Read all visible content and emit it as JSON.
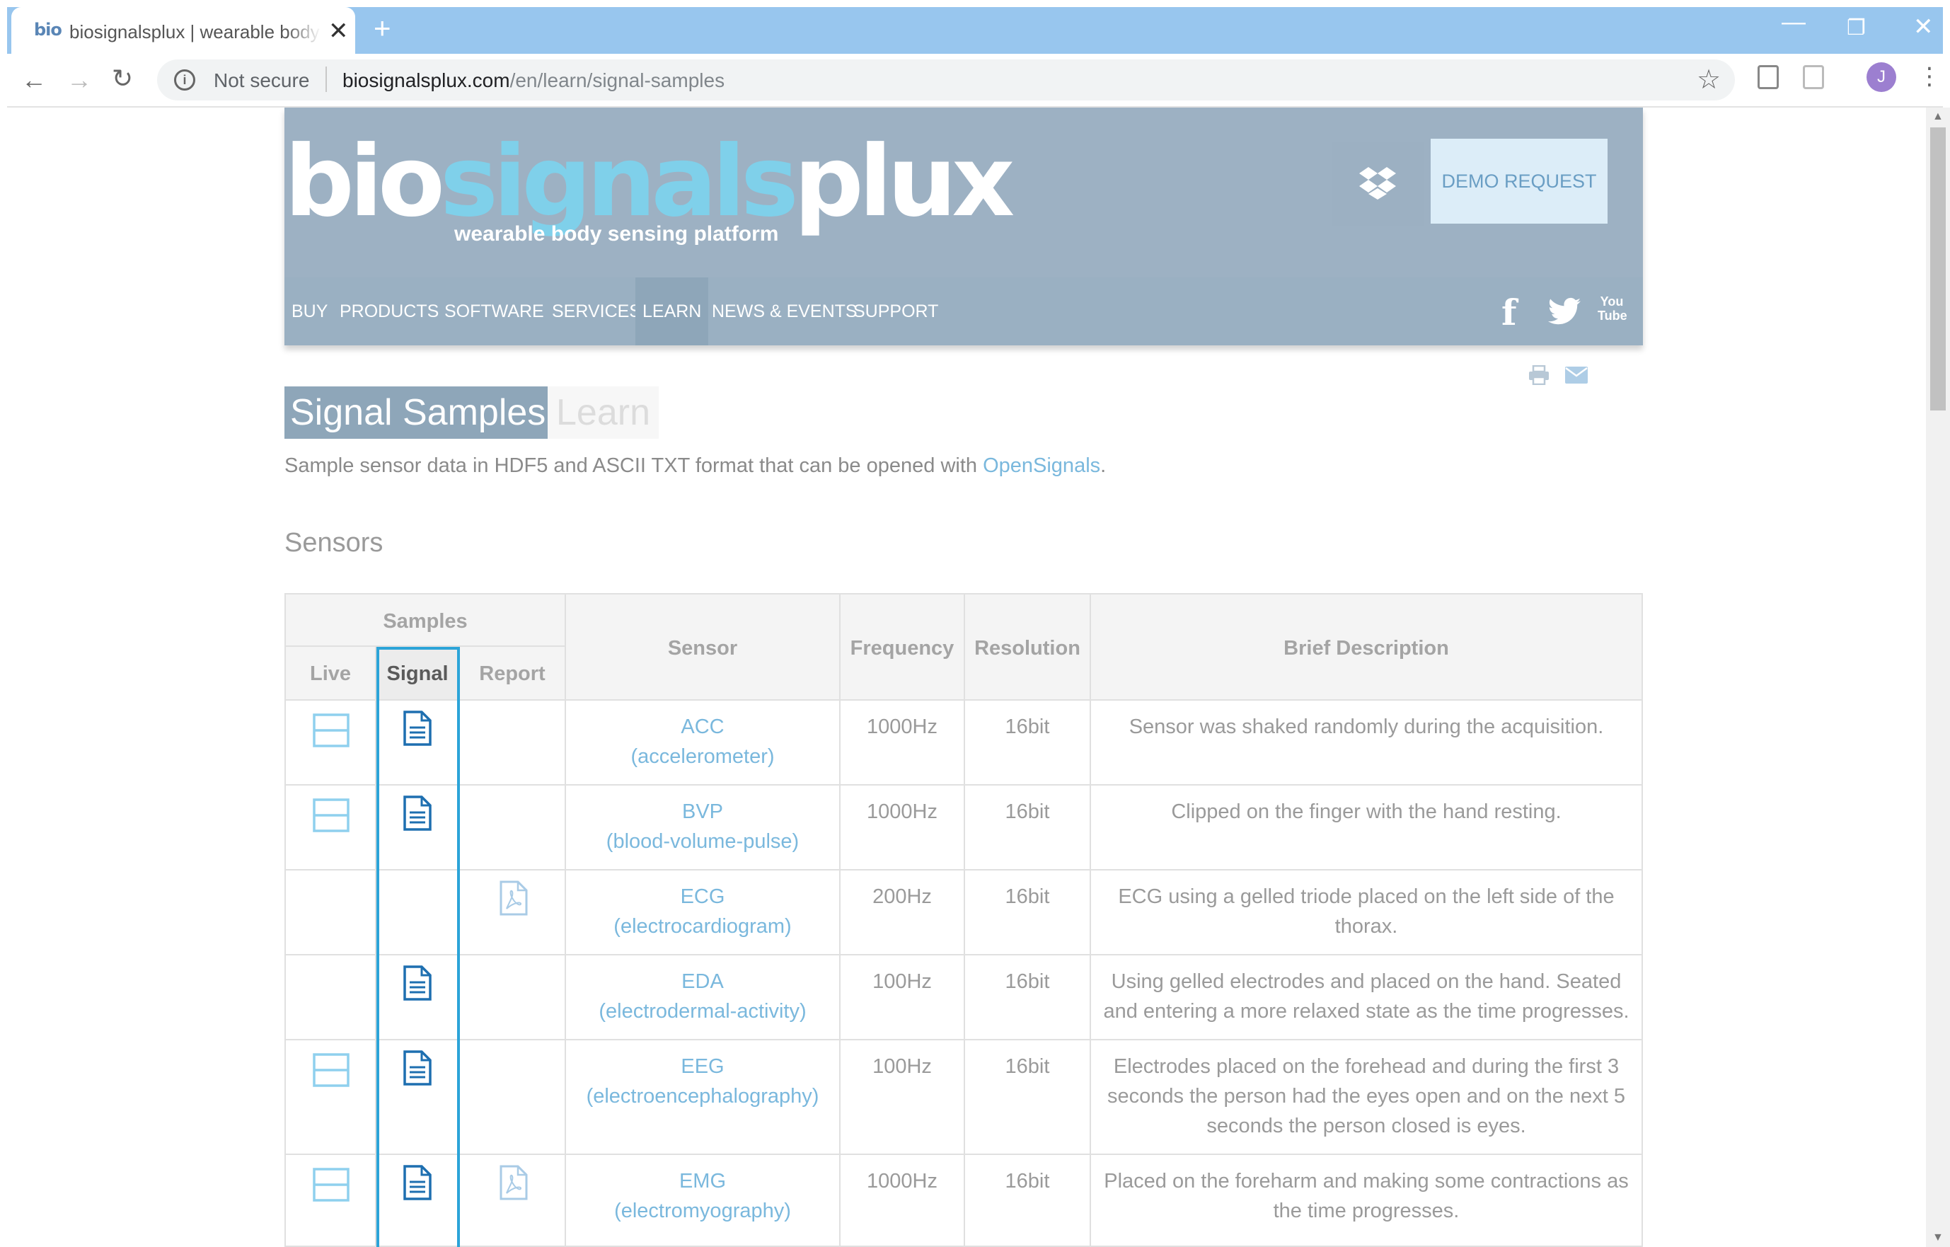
{
  "browser": {
    "tab_title": "biosignalsplux | wearable body sensing platform",
    "tab_favicon": "bio",
    "close_glyph": "✕",
    "new_tab_glyph": "+",
    "security_label": "Not secure",
    "url_host": "biosignalsplux.com",
    "url_path": "/en/learn/signal-samples",
    "profile_initial": "J"
  },
  "site": {
    "logo_parts": [
      "bio",
      "signals",
      "plux"
    ],
    "tagline": "wearable body sensing platform",
    "demo_button": "DEMO REQUEST",
    "nav": [
      "BUY",
      "PRODUCTS",
      "SOFTWARE",
      "SERVICES",
      "LEARN",
      "NEWS & EVENTS",
      "SUPPORT"
    ],
    "active_nav": "LEARN",
    "social_youtube_top": "You",
    "social_youtube_bottom": "Tube"
  },
  "page": {
    "title": "Signal Samples",
    "title_secondary": "Learn",
    "intro_text": "Sample sensor data in HDF5 and ASCII TXT format that can be opened with ",
    "intro_link": "OpenSignals",
    "intro_end": ".",
    "section_heading": "Sensors"
  },
  "table": {
    "group_header": "Samples",
    "headers": {
      "live": "Live",
      "signal": "Signal",
      "report": "Report",
      "sensor": "Sensor",
      "frequency": "Frequency",
      "resolution": "Resolution",
      "description": "Brief Description"
    },
    "rows": [
      {
        "code": "ACC",
        "name": "(accelerometer)",
        "frequency": "1000Hz",
        "resolution": "16bit",
        "description": "Sensor was shaked randomly during the acquisition.",
        "live": true,
        "signal": true,
        "report": false
      },
      {
        "code": "BVP",
        "name": "(blood-volume-pulse)",
        "frequency": "1000Hz",
        "resolution": "16bit",
        "description": "Clipped on the finger with the hand resting.",
        "live": true,
        "signal": true,
        "report": false
      },
      {
        "code": "ECG",
        "name": "(electrocardiogram)",
        "frequency": "200Hz",
        "resolution": "16bit",
        "description": "ECG using a gelled triode placed on the left side of the thorax.",
        "live": false,
        "signal": false,
        "report": true
      },
      {
        "code": "EDA",
        "name": "(electrodermal-activity)",
        "frequency": "100Hz",
        "resolution": "16bit",
        "description": "Using gelled electrodes and placed on the hand. Seated and entering a more relaxed state as the time progresses.",
        "live": false,
        "signal": true,
        "report": false
      },
      {
        "code": "EEG",
        "name": "(electroencephalography)",
        "frequency": "100Hz",
        "resolution": "16bit",
        "description": "Electrodes placed on the forehead and during the first 3 seconds the person had the eyes open and on the next 5 seconds the person closed is eyes.",
        "live": true,
        "signal": true,
        "report": false
      },
      {
        "code": "EMG",
        "name": "(electromyography)",
        "frequency": "1000Hz",
        "resolution": "16bit",
        "description": "Placed on the foreharm and making some contractions as the time progresses.",
        "live": true,
        "signal": true,
        "report": true
      }
    ]
  },
  "colors": {
    "header_bg": "#9db1c3",
    "accent_link": "#7ab8dd",
    "highlight_border": "#2ca4d8"
  },
  "icons": [
    "info-icon",
    "star-icon",
    "dropbox-icon",
    "facebook-icon",
    "twitter-icon",
    "youtube-icon",
    "print-icon",
    "mail-icon",
    "live-view-icon",
    "signal-file-icon",
    "pdf-report-icon"
  ]
}
